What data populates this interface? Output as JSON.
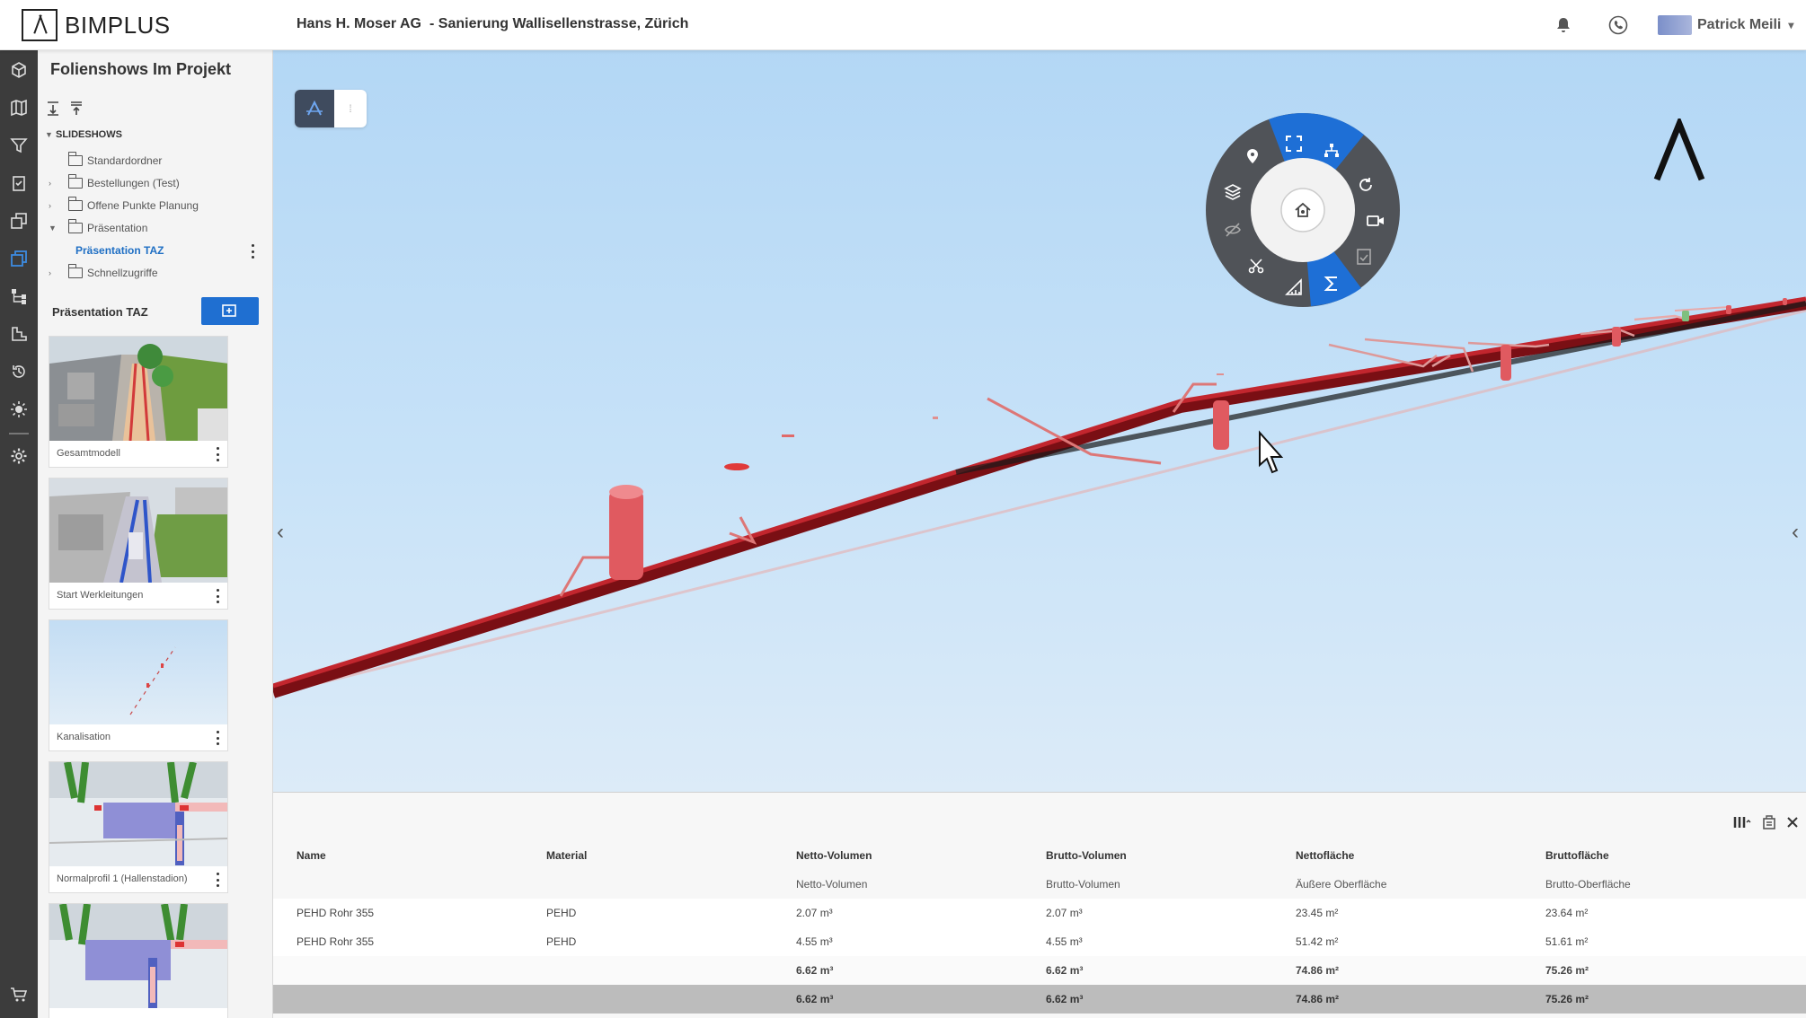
{
  "header": {
    "logo_text": "BIMPLUS",
    "company": "Hans H. Moser AG",
    "project": "-  Sanierung Wallisellenstrasse, Zürich",
    "user_name": "Patrick Meili",
    "icons": [
      "bell-icon",
      "phone-icon"
    ]
  },
  "rail": {
    "items": [
      "cube-icon",
      "map-icon",
      "filter-icon",
      "clipboard-icon",
      "layers-copy-icon",
      "slides-icon",
      "hierarchy-icon",
      "steps-icon",
      "history-icon",
      "brightness-icon",
      "settings-icon",
      "cart-icon"
    ],
    "active_index": 5
  },
  "panel": {
    "title": "Folienshows Im Projekt",
    "tree_root": "SLIDESHOWS",
    "tree": [
      {
        "label": "Standardordner",
        "expandable": false
      },
      {
        "label": "Bestellungen (Test)",
        "expandable": true
      },
      {
        "label": "Offene Punkte Planung",
        "expandable": true
      },
      {
        "label": "Präsentation",
        "expandable": true,
        "expanded": true
      },
      {
        "label": "Präsentation TAZ",
        "active": true
      },
      {
        "label": "Schnellzugriffe",
        "expandable": true
      }
    ],
    "presentation_title": "Präsentation TAZ",
    "slides": [
      {
        "label": "Gesamtmodell"
      },
      {
        "label": "Start Werkleitungen"
      },
      {
        "label": "Kanalisation"
      },
      {
        "label": "Normalprofil 1 (Hallenstadion)"
      },
      {
        "label": ""
      }
    ]
  },
  "viewport": {
    "radial_menu": {
      "items": [
        "fullscreen-icon",
        "hierarchy-icon",
        "refresh-icon",
        "video-icon",
        "checklist-icon",
        "sigma-icon",
        "measure-icon",
        "cut-icon",
        "hide-icon",
        "layers-icon",
        "location-icon"
      ],
      "center": "home-icon",
      "active": [
        "fullscreen-icon",
        "hierarchy-icon",
        "sigma-icon"
      ]
    }
  },
  "table": {
    "columns": [
      "Name",
      "Material",
      "Netto-Volumen",
      "Brutto-Volumen",
      "Nettofläche",
      "Bruttofläche"
    ],
    "subheaders": [
      "",
      "",
      "Netto-Volumen",
      "Brutto-Volumen",
      "Äußere Oberfläche",
      "Brutto-Oberfläche"
    ],
    "rows": [
      [
        "PEHD Rohr 355",
        "PEHD",
        "2.07 m³",
        "2.07 m³",
        "23.45 m²",
        "23.64 m²"
      ],
      [
        "PEHD Rohr 355",
        "PEHD",
        "4.55 m³",
        "4.55 m³",
        "51.42 m²",
        "51.61 m²"
      ]
    ],
    "sum_row": [
      "",
      "",
      "6.62 m³",
      "6.62 m³",
      "74.86 m²",
      "75.26 m²"
    ],
    "total_row": [
      "",
      "",
      "6.62 m³",
      "6.62 m³",
      "74.86 m²",
      "75.26 m²"
    ]
  }
}
